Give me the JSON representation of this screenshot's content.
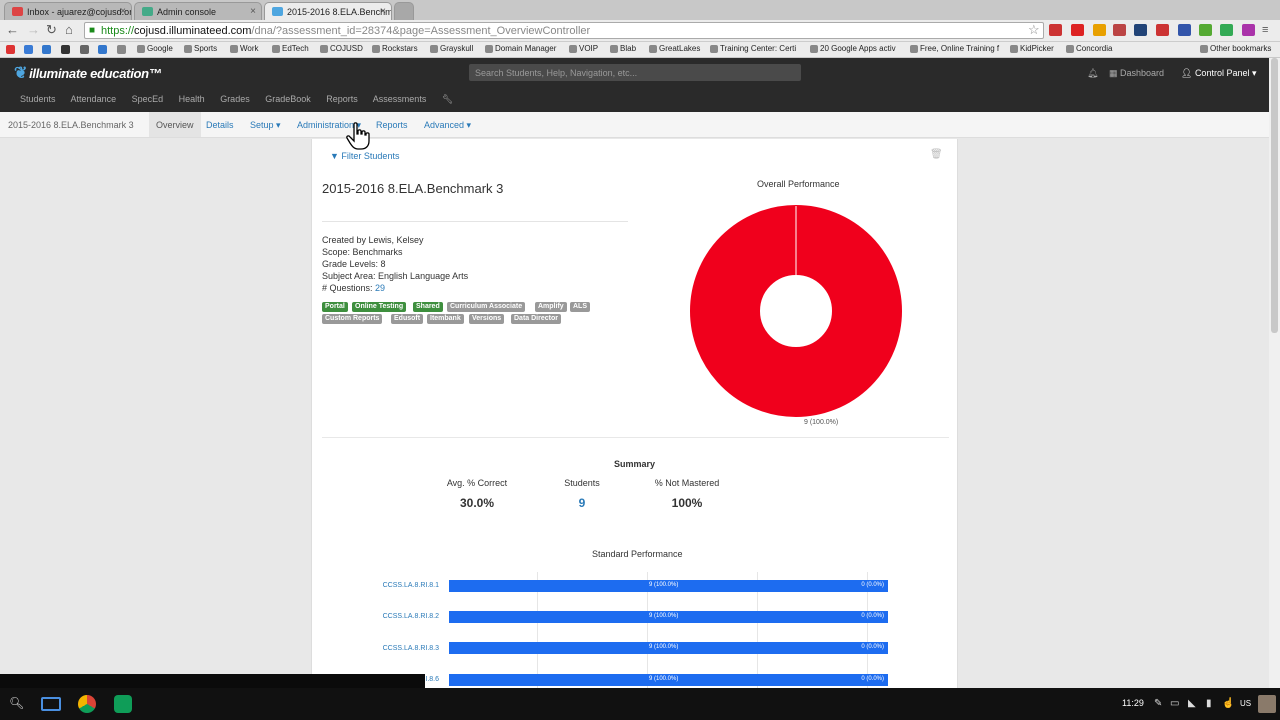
{
  "browser": {
    "tabs": [
      {
        "title": "Inbox - ajuarez@cojusd.or"
      },
      {
        "title": "Admin console"
      },
      {
        "title": "2015-2016 8.ELA.Benchm"
      }
    ],
    "url_scheme": "https://",
    "url_domain": "cojusd.illuminateed.com",
    "url_path": "/dna/?assessment_id=28374&page=Assessment_OverviewController",
    "bookmarks": [
      "Google",
      "Sports",
      "Work",
      "EdTech",
      "COJUSD",
      "Rockstars",
      "Grayskull",
      "Domain Manager",
      "VOIP",
      "Blab",
      "GreatLakes",
      "Training Center: Certi",
      "20 Google Apps activ",
      "Free, Online Training f",
      "KidPicker",
      "Concordia"
    ],
    "other_bookmarks": "Other bookmarks"
  },
  "app": {
    "logo": "illuminate education",
    "search_placeholder": "Search Students, Help, Navigation, etc...",
    "dashboard": "Dashboard",
    "control_panel": "Control Panel",
    "main_nav": [
      "Students",
      "Attendance",
      "SpecEd",
      "Health",
      "Grades",
      "GradeBook",
      "Reports",
      "Assessments"
    ]
  },
  "subnav": {
    "title": "2015-2016 8.ELA.Benchmark 3",
    "overview": "Overview",
    "details": "Details",
    "setup": "Setup",
    "administration": "Administration",
    "reports": "Reports",
    "advanced": "Advanced"
  },
  "assessment": {
    "filter": "Filter Students",
    "title": "2015-2016 8.ELA.Benchmark 3",
    "created_by": "Created by Lewis, Kelsey",
    "scope": "Scope: Benchmarks",
    "grade_levels": "Grade Levels: 8",
    "subject_area": "Subject Area: English Language Arts",
    "questions_label": "# Questions:",
    "questions_count": "29",
    "badges_green": [
      "Portal",
      "Online Testing",
      "Shared"
    ],
    "badges_gray_row1": [
      "Curriculum Associate",
      "Amplify",
      "ALS"
    ],
    "badges_gray_row2": [
      "Custom Reports",
      "Edusoft",
      "Itembank",
      "Versions",
      "Data Director"
    ]
  },
  "overall": {
    "title": "Overall Performance",
    "label": "9 (100.0%)",
    "color": "#f0001c"
  },
  "summary": {
    "title": "Summary",
    "avg_label": "Avg. % Correct",
    "avg_value": "30.0%",
    "students_label": "Students",
    "students_value": "9",
    "notmastered_label": "% Not Mastered",
    "notmastered_value": "100%"
  },
  "standards": {
    "title": "Standard Performance",
    "rows": [
      {
        "label": "CCSS.LA.8.RI.8.1",
        "mid": "9 (100.0%)",
        "end": "0 (0.0%)"
      },
      {
        "label": "CCSS.LA.8.RI.8.2",
        "mid": "9 (100.0%)",
        "end": "0 (0.0%)"
      },
      {
        "label": "CCSS.LA.8.RI.8.3",
        "mid": "9 (100.0%)",
        "end": "0 (0.0%)"
      },
      {
        "label": "RI.8.6",
        "mid": "9 (100.0%)",
        "end": "0 (0.0%)"
      }
    ],
    "bar_color": "#1d6cf0"
  },
  "taskbar": {
    "clock": "11:29",
    "locale": "US"
  }
}
